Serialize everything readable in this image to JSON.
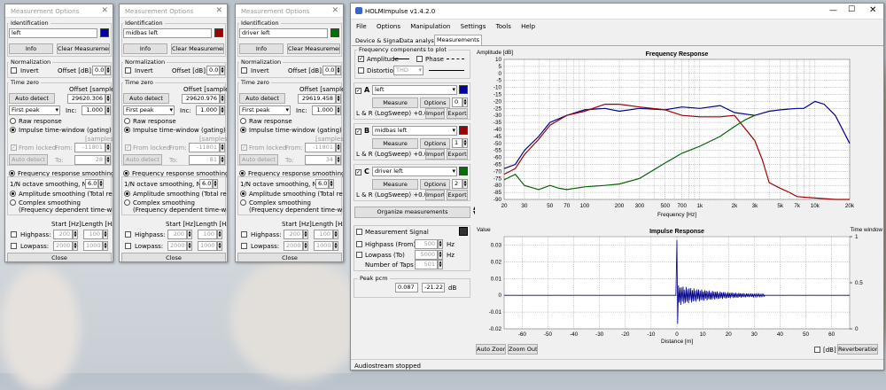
{
  "meas_windows": [
    {
      "title": "Measurement Options",
      "identification_label": "Identification",
      "name": "left",
      "color": "#0000a0",
      "info": "Info",
      "clear": "Clear Measurement",
      "normalization_label": "Normalization",
      "invert": "Invert",
      "offset_db_label": "Offset [dB]:",
      "offset_db": "0.0",
      "time_zero_label": "Time zero",
      "offset_samples_label": "Offset [samples]",
      "auto_detect": "Auto detect",
      "offset_samples": "29620.306",
      "peak_mode": "First peak",
      "inc_label": "Inc:",
      "inc": "1.000",
      "raw": "Raw response",
      "gating": "Impulse time-window (gating)",
      "samples_label": "[samples]",
      "from_locked": "From locked",
      "from_label": "From:",
      "from_val": "-11801",
      "auto_detect2": "Auto detect",
      "to_label": "To:",
      "to_val": "28",
      "smoothing": "Frequency response smoothing",
      "octave_label": "1/N octave smoothing, N=",
      "octave_val": "6.0",
      "amp_smooth": "Amplitude smoothing (Total response)",
      "complex_smooth": "Complex smoothing",
      "complex_sub": "(Frequency dependent time-window)",
      "start_label": "Start [Hz]",
      "length_label": "Length [Hz]",
      "highpass": "Highpass:",
      "hp_start": "200",
      "hp_len": "100",
      "lowpass": "Lowpass:",
      "lp_start": "2000",
      "lp_len": "1000",
      "close": "Close"
    },
    {
      "title": "Measurement Options",
      "identification_label": "Identification",
      "name": "midbas left",
      "color": "#a00000",
      "info": "Info",
      "clear": "Clear Measurement",
      "normalization_label": "Normalization",
      "invert": "Invert",
      "offset_db_label": "Offset [dB]:",
      "offset_db": "0.0",
      "time_zero_label": "Time zero",
      "offset_samples_label": "Offset [samples]",
      "auto_detect": "Auto detect",
      "offset_samples": "29620.976",
      "peak_mode": "First peak",
      "inc_label": "Inc:",
      "inc": "1.000",
      "raw": "Raw response",
      "gating": "Impulse time-window (gating)",
      "samples_label": "[samples]",
      "from_locked": "From locked",
      "from_label": "From:",
      "from_val": "-11801",
      "auto_detect2": "Auto detect",
      "to_label": "To:",
      "to_val": "81",
      "smoothing": "Frequency response smoothing",
      "octave_label": "1/N octave smoothing, N=",
      "octave_val": "6.0",
      "amp_smooth": "Amplitude smoothing (Total response)",
      "complex_smooth": "Complex smoothing",
      "complex_sub": "(Frequency dependent time-window)",
      "start_label": "Start [Hz]",
      "length_label": "Length [Hz]",
      "highpass": "Highpass:",
      "hp_start": "200",
      "hp_len": "100",
      "lowpass": "Lowpass:",
      "lp_start": "2000",
      "lp_len": "1000",
      "close": "Close"
    },
    {
      "title": "Measurement Options",
      "identification_label": "Identification",
      "name": "driver left",
      "color": "#007000",
      "info": "Info",
      "clear": "Clear Measurement",
      "normalization_label": "Normalization",
      "invert": "Invert",
      "offset_db_label": "Offset [dB]:",
      "offset_db": "0.0",
      "time_zero_label": "Time zero",
      "offset_samples_label": "Offset [samples]",
      "auto_detect": "Auto detect",
      "offset_samples": "29619.458",
      "peak_mode": "First peak",
      "inc_label": "Inc:",
      "inc": "1.000",
      "raw": "Raw response",
      "gating": "Impulse time-window (gating)",
      "samples_label": "[samples]",
      "from_locked": "From locked",
      "from_label": "From:",
      "from_val": "-11801",
      "auto_detect2": "Auto detect",
      "to_label": "To:",
      "to_val": "34",
      "smoothing": "Frequency response smoothing",
      "octave_label": "1/N octave smoothing, N=",
      "octave_val": "6.0",
      "amp_smooth": "Amplitude smoothing (Total response)",
      "complex_smooth": "Complex smoothing",
      "complex_sub": "(Frequency dependent time-window)",
      "start_label": "Start [Hz]",
      "length_label": "Length [Hz]",
      "highpass": "Highpass:",
      "hp_start": "200",
      "hp_len": "100",
      "lowpass": "Lowpass:",
      "lp_start": "2000",
      "lp_len": "1000",
      "close": "Close"
    }
  ],
  "main": {
    "title": "HOLMImpulse  v1.4.2.0",
    "menu": [
      "File",
      "Options",
      "Manipulation",
      "Settings",
      "Tools",
      "Help"
    ],
    "tabs": [
      "Device & Signal",
      "Data analysis",
      "Measurements"
    ],
    "components_label": "Frequency components to plot",
    "amplitude": "Amplitude",
    "phase": "Phase",
    "distortion": "Distortion",
    "distortion_select": "THD",
    "measurements": [
      {
        "letter": "A",
        "name": "left",
        "color": "#0000a0",
        "measure": "Measure",
        "options": "Options",
        "num": "0",
        "desc": "L & R (LogSweep) +0.0dB",
        "import": "Import",
        "export": "Export"
      },
      {
        "letter": "B",
        "name": "midbas left",
        "color": "#a00000",
        "measure": "Measure",
        "options": "Options",
        "num": "1",
        "desc": "L & R (LogSweep) +0.0dB",
        "import": "Import",
        "export": "Export"
      },
      {
        "letter": "C",
        "name": "driver left",
        "color": "#007000",
        "measure": "Measure",
        "options": "Options",
        "num": "2",
        "desc": "L & R (LogSweep) +0.0dB",
        "import": "Import",
        "export": "Export"
      }
    ],
    "organize": "Organize measurements",
    "meas_signal": "Measurement Signal",
    "hp_from": "Highpass (From)",
    "hp_from_val": "500",
    "lp_to": "Lowpass (To)",
    "lp_to_val": "5000",
    "hz": "Hz",
    "taps": "Number of Taps",
    "taps_val": "501",
    "peak_label": "Peak pcm",
    "peak_val": "0.087",
    "peak_db": "-21.22",
    "db": "dB",
    "auto_zoom": "Auto Zoom",
    "zoom_out": "Zoom Out",
    "db_chk": "[dB]",
    "reverb": "Reverberation",
    "status": "Audiostream stopped"
  },
  "chart_data": [
    {
      "type": "line",
      "title": "Frequency Response",
      "ylabel": "Amplitude [dB]",
      "xlabel": "Frequency [Hz]",
      "xscale": "log",
      "xlim": [
        20,
        20000
      ],
      "ylim": [
        -90,
        10
      ],
      "xticks": [
        "20",
        "30",
        "50",
        "70",
        "100",
        "200",
        "300",
        "500",
        "700",
        "1k",
        "2k",
        "3k",
        "5k",
        "7k",
        "10k",
        "20k"
      ],
      "yticks": [
        "10",
        "5",
        "0",
        "-5",
        "-10",
        "-15",
        "-20",
        "-25",
        "-30",
        "-35",
        "-40",
        "-45",
        "-50",
        "-55",
        "-60",
        "-65",
        "-70",
        "-75",
        "-80",
        "-85",
        "-90"
      ],
      "series": [
        {
          "color": "#00008b",
          "x": [
            20,
            25,
            30,
            40,
            50,
            70,
            100,
            150,
            200,
            300,
            500,
            700,
            1000,
            1500,
            2000,
            3000,
            4000,
            5000,
            7000,
            8000,
            10000,
            12000,
            15000,
            20000
          ],
          "y": [
            -68,
            -65,
            -55,
            -45,
            -35,
            -30,
            -26,
            -25,
            -27,
            -25,
            -26,
            -24,
            -25,
            -23,
            -28,
            -30,
            -27,
            -26,
            -25,
            -25,
            -20,
            -22,
            -30,
            -50
          ]
        },
        {
          "color": "#a00000",
          "x": [
            20,
            25,
            30,
            40,
            50,
            70,
            100,
            150,
            200,
            300,
            500,
            700,
            1000,
            1500,
            2000,
            3000,
            3500,
            4000,
            5000,
            6000,
            7000,
            10000,
            15000,
            20000
          ],
          "y": [
            -72,
            -68,
            -58,
            -47,
            -37,
            -30,
            -27,
            -22,
            -22,
            -24,
            -26,
            -30,
            -31,
            -31,
            -30,
            -48,
            -62,
            -78,
            -82,
            -85,
            -88,
            -89,
            -90,
            -90
          ]
        },
        {
          "color": "#006400",
          "x": [
            20,
            25,
            30,
            40,
            50,
            60,
            70,
            100,
            150,
            200,
            300,
            500,
            700,
            1000,
            1500,
            2000,
            2500,
            3000
          ],
          "y": [
            -76,
            -72,
            -80,
            -83,
            -80,
            -82,
            -83,
            -81,
            -80,
            -79,
            -75,
            -64,
            -57,
            -52,
            -45,
            -38,
            -33,
            -30
          ]
        }
      ]
    },
    {
      "type": "line",
      "title": "Impulse Response",
      "ylabel": "Value",
      "y2label": "Time window",
      "xlabel": "Distance [m]",
      "xlim": [
        -67,
        67
      ],
      "ylim": [
        -0.02,
        0.035
      ],
      "xticks": [
        "-60",
        "-50",
        "-40",
        "-30",
        "-20",
        "-10",
        "0",
        "10",
        "20",
        "30",
        "40",
        "50",
        "60"
      ],
      "yticks": [
        "0.03",
        "0.02",
        "0.01",
        "0",
        "-0.01",
        "-0.02"
      ],
      "y2ticks": [
        "1",
        "0.5",
        "0"
      ]
    }
  ]
}
